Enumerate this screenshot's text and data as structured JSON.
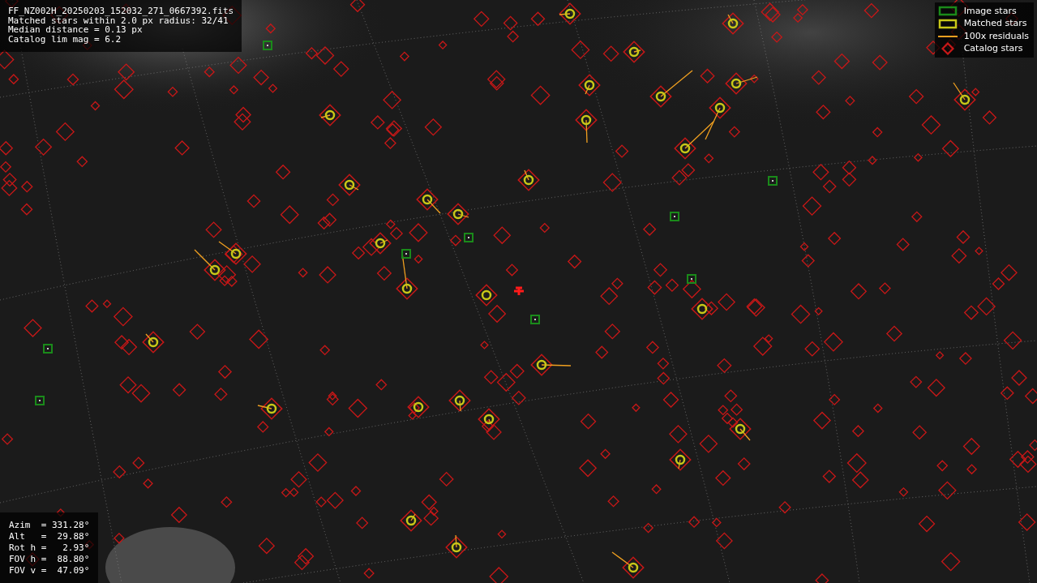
{
  "info_box": {
    "lines": [
      "FF_NZ002H_20250203_152032_271_0667392.fits",
      "Matched stars within 2.0 px radius: 32/41",
      "Median distance = 0.13 px",
      "Catalog lim mag = 6.2"
    ]
  },
  "legend": {
    "items": [
      {
        "kind": "image",
        "label": "Image stars",
        "color": "#1a8a1a"
      },
      {
        "kind": "matched",
        "label": "Matched stars",
        "color": "#c8c818"
      },
      {
        "kind": "residual",
        "label": "100x residuals",
        "color": "#f0a020"
      },
      {
        "kind": "catalog",
        "label": "Catalog stars",
        "color": "#c81818"
      }
    ]
  },
  "pointing_box": {
    "lines": [
      "Azim  = 331.28°",
      "Alt   =  29.88°",
      "Rot h =   2.93°",
      "FOV h =  88.80°",
      "FOV v =  47.09°"
    ]
  }
}
